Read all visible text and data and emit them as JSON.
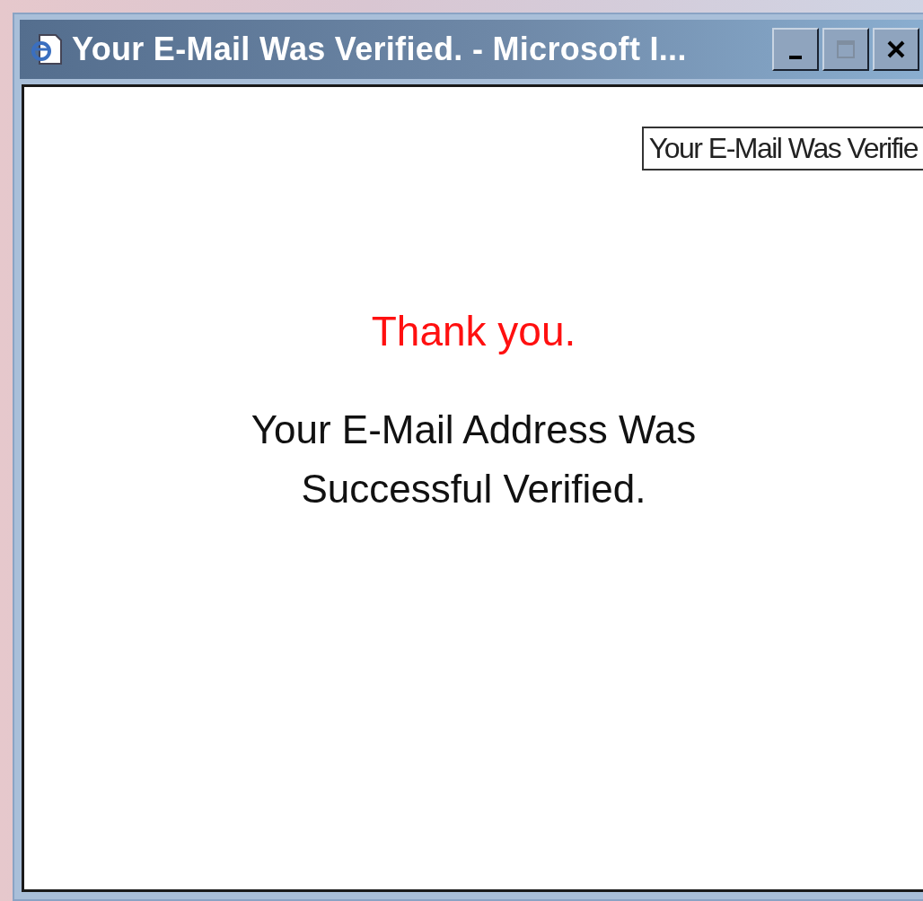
{
  "window": {
    "title": "Your E-Mail Was Verified. - Microsoft I..."
  },
  "tooltip": {
    "text": "Your E-Mail Was Verifie"
  },
  "content": {
    "heading": "Thank you.",
    "message_lines": [
      "Your E-Mail Address Was",
      "Successful Verified."
    ]
  }
}
